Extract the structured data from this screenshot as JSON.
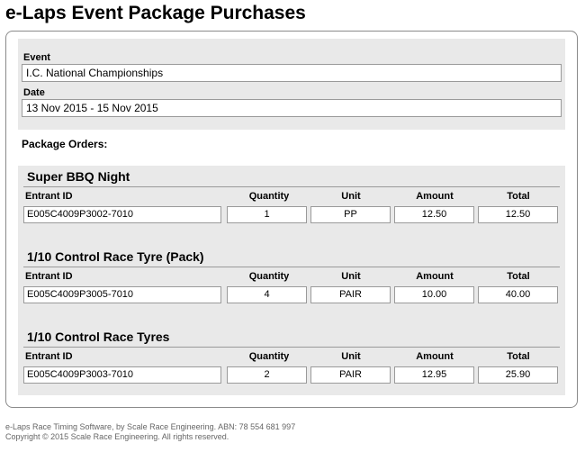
{
  "page": {
    "title": "e-Laps Event Package Purchases"
  },
  "event": {
    "event_label": "Event",
    "event_value": "I.C. National Championships",
    "date_label": "Date",
    "date_value": "13 Nov 2015 - 15 Nov 2015"
  },
  "orders": {
    "heading": "Package Orders:",
    "columns": {
      "entrant": "Entrant ID",
      "quantity": "Quantity",
      "unit": "Unit",
      "amount": "Amount",
      "total": "Total"
    },
    "packages": [
      {
        "name": "Super BBQ Night",
        "entrant_id": "E005C4009P3002-7010",
        "quantity": "1",
        "unit": "PP",
        "amount": "12.50",
        "total": "12.50"
      },
      {
        "name": "1/10 Control Race Tyre (Pack)",
        "entrant_id": "E005C4009P3005-7010",
        "quantity": "4",
        "unit": "PAIR",
        "amount": "10.00",
        "total": "40.00"
      },
      {
        "name": "1/10 Control Race Tyres",
        "entrant_id": "E005C4009P3003-7010",
        "quantity": "2",
        "unit": "PAIR",
        "amount": "12.95",
        "total": "25.90"
      }
    ]
  },
  "footer": {
    "line1": "e-Laps Race Timing Software, by Scale Race Engineering. ABN: 78 554 681 997",
    "line2": "Copyright © 2015 Scale Race Engineering. All rights reserved."
  }
}
